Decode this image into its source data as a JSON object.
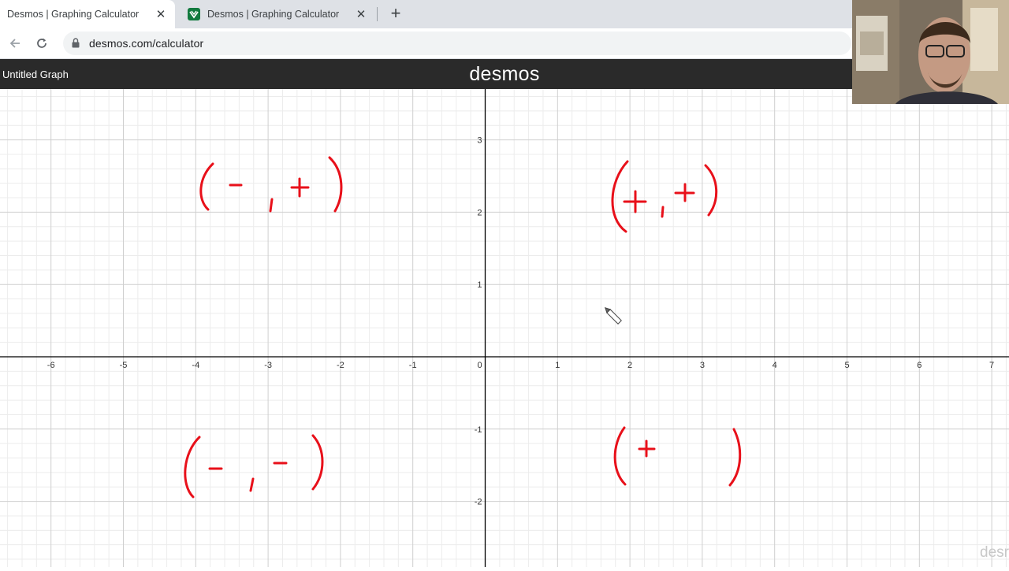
{
  "browser": {
    "tabs": [
      {
        "title": "Desmos | Graphing Calculator",
        "active": true
      },
      {
        "title": "Desmos | Graphing Calculator",
        "active": false
      }
    ],
    "new_tab": "+",
    "url": "desmos.com/calculator"
  },
  "desmos": {
    "graph_title": "Untitled Graph",
    "logo": "desmos",
    "watermark": "desr"
  },
  "graph": {
    "x_ticks": [
      "-6",
      "-5",
      "-4",
      "-3",
      "-2",
      "-1",
      "0",
      "1",
      "2",
      "3",
      "4",
      "5",
      "6",
      "7"
    ],
    "y_ticks": [
      "3",
      "2",
      "1",
      "-1",
      "-2"
    ]
  },
  "annotations": [
    {
      "quadrant": "I",
      "text": "(+ , +)"
    },
    {
      "quadrant": "II",
      "text": "(- , +)"
    },
    {
      "quadrant": "III",
      "text": "(- , -)"
    },
    {
      "quadrant": "IV",
      "text": "(+     )"
    }
  ],
  "colors": {
    "ink": "#e8101a",
    "axis": "#000000",
    "major_grid": "#cfcfcf",
    "minor_grid": "#ececec",
    "header_bg": "#2a2a2a",
    "tabstrip_bg": "#dee1e6"
  },
  "icons": [
    "back-arrow-icon",
    "reload-icon",
    "lock-icon",
    "close-icon",
    "desmos-favicon-icon",
    "pencil-cursor-icon"
  ]
}
